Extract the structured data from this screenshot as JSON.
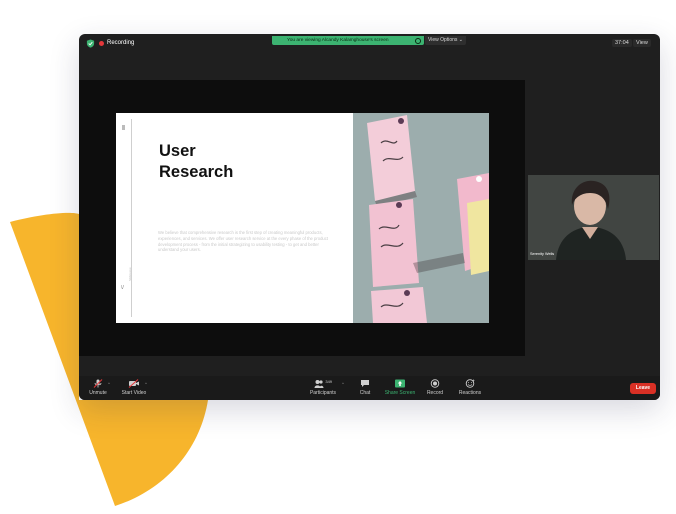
{
  "topbar": {
    "recording_label": "Recording",
    "viewing_banner": "You are viewing Alcandy Kalamghouse's screen",
    "view_options_label": "View Options ⌄",
    "timer": "37:04",
    "view_label": "View"
  },
  "slide": {
    "title_line1": "User",
    "title_line2": "Research",
    "body": "We believe that comprehensive research is the first step of creating meaningful products, experiences, and services. We offer user research service at the every phase of the product development process - from the initial strategizing to usability testing - to get and better understand your users.",
    "vertical_label": "Slidewave",
    "left_mark": "\\/"
  },
  "participant": {
    "name": "Serenity Wells"
  },
  "toolbar": {
    "unmute_label": "Unmute",
    "start_video_label": "Start Video",
    "participants_label": "Participants",
    "participants_count": "349",
    "chat_label": "Chat",
    "share_screen_label": "Share Screen",
    "record_label": "Record",
    "reactions_label": "Reactions",
    "leave_label": "Leave"
  },
  "colors": {
    "accent_green": "#3cb371",
    "leave_red": "#d93025",
    "decor_yellow": "#f7b52c"
  },
  "icons": [
    "shield-icon",
    "mic-muted-icon",
    "video-off-icon",
    "participants-icon",
    "chat-icon",
    "share-screen-icon",
    "record-icon",
    "reactions-icon"
  ]
}
